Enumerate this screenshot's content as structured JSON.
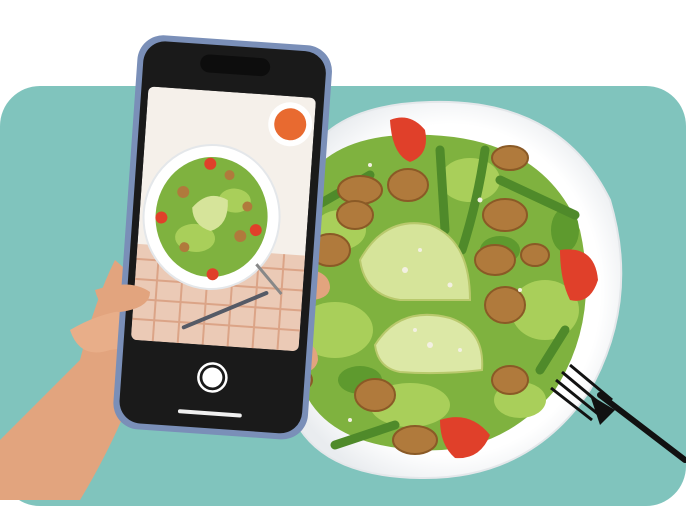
{
  "colors": {
    "background": "#ffffff",
    "card": "#80c4bd",
    "plate": "#ffffff",
    "lettuce_light": "#a9cf5a",
    "lettuce_dark": "#5e9a2e",
    "bean": "#4f8a2a",
    "avocado": "#d6e49a",
    "walnut": "#b07a3c",
    "tomato": "#e0402a",
    "phone_frame": "#7a8fb8",
    "phone_body": "#1a1a1a",
    "skin": "#e2a47e"
  },
  "icons": {
    "shutter": "camera-shutter-icon",
    "fork": "fork-icon",
    "knife": "knife-icon"
  }
}
